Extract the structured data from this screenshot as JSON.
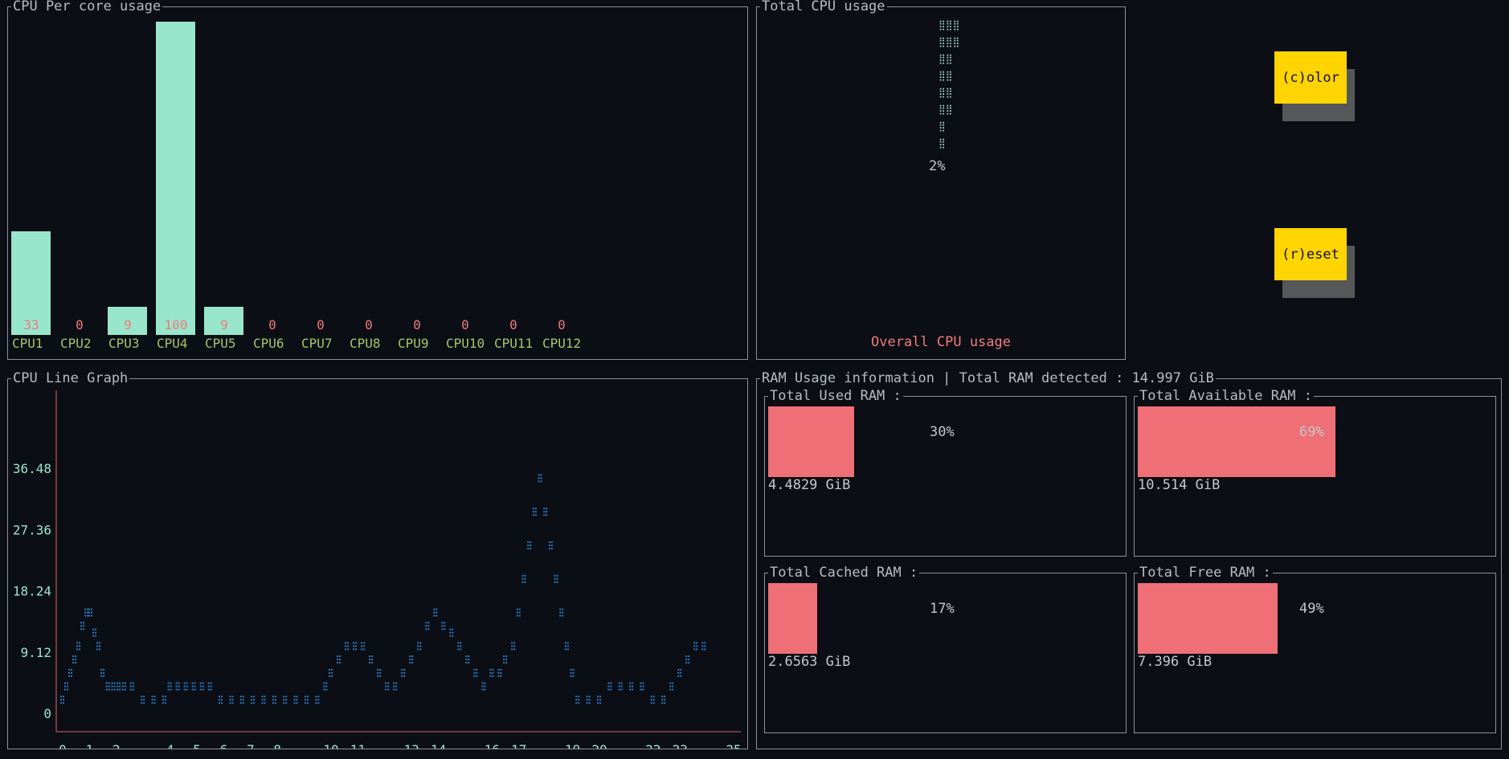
{
  "cpu_panel": {
    "title": "CPU Per core usage",
    "cores": [
      {
        "label": "CPU1",
        "value": 33
      },
      {
        "label": "CPU2",
        "value": 0
      },
      {
        "label": "CPU3",
        "value": 9
      },
      {
        "label": "CPU4",
        "value": 100
      },
      {
        "label": "CPU5",
        "value": 9
      },
      {
        "label": "CPU6",
        "value": 0
      },
      {
        "label": "CPU7",
        "value": 0
      },
      {
        "label": "CPU8",
        "value": 0
      },
      {
        "label": "CPU9",
        "value": 0
      },
      {
        "label": "CPU10",
        "value": 0
      },
      {
        "label": "CPU11",
        "value": 0
      },
      {
        "label": "CPU12",
        "value": 0
      }
    ],
    "bar_color": "#98e6cc",
    "value_color": "#ee7a7f",
    "label_color": "#a7c46a"
  },
  "total_cpu": {
    "title": "Total CPU usage",
    "percent_label": "2%",
    "footer": "Overall CPU usage",
    "footer_color": "#ee7a7f",
    "value": 2
  },
  "buttons": {
    "color_label": "(c)olor",
    "reset_label": "(r)eset",
    "bg_color": "#ffd400"
  },
  "line_graph": {
    "title": "CPU Line Graph"
  },
  "ram": {
    "title": "RAM Usage information | Total RAM detected : 14.997 GiB",
    "boxes": [
      {
        "title": "Total Used RAM :",
        "percent": 30,
        "percent_label": "30%",
        "value": "4.4829 GiB"
      },
      {
        "title": "Total Available RAM :",
        "percent": 69,
        "percent_label": "69%",
        "value": "10.514 GiB"
      },
      {
        "title": "Total Cached RAM :",
        "percent": 17,
        "percent_label": "17%",
        "value": "2.6563 GiB"
      },
      {
        "title": "Total Free RAM :",
        "percent": 49,
        "percent_label": "49%",
        "value": "7.396 GiB"
      }
    ],
    "bar_color": "#ef6f76"
  },
  "chart_data": {
    "type": "line",
    "title": "CPU Line Graph",
    "xlabel": "",
    "ylabel": "",
    "x_ticks": [
      "0",
      "1",
      "2",
      "4",
      "5",
      "6",
      "7",
      "8",
      "10",
      "11",
      "13",
      "14",
      "16",
      "17",
      "19",
      "20",
      "22",
      "23",
      "25"
    ],
    "y_ticks": [
      "0",
      "9.12",
      "18.24",
      "27.36",
      "36.48"
    ],
    "ylim": [
      0,
      36.48
    ],
    "xlim": [
      0,
      25
    ],
    "series": [
      {
        "values": [
          [
            0.0,
            2
          ],
          [
            0.15,
            4
          ],
          [
            0.3,
            6
          ],
          [
            0.45,
            8
          ],
          [
            0.6,
            10
          ],
          [
            0.75,
            13
          ],
          [
            0.9,
            15
          ],
          [
            1.05,
            15
          ],
          [
            1.2,
            12
          ],
          [
            1.35,
            10
          ],
          [
            1.5,
            6
          ],
          [
            1.7,
            4
          ],
          [
            1.9,
            4
          ],
          [
            2.1,
            4
          ],
          [
            2.3,
            4
          ],
          [
            2.6,
            4
          ],
          [
            3.0,
            2
          ],
          [
            3.4,
            2
          ],
          [
            3.8,
            2
          ],
          [
            4.0,
            4
          ],
          [
            4.3,
            4
          ],
          [
            4.6,
            4
          ],
          [
            4.9,
            4
          ],
          [
            5.2,
            4
          ],
          [
            5.5,
            4
          ],
          [
            5.9,
            2
          ],
          [
            6.3,
            2
          ],
          [
            6.7,
            2
          ],
          [
            7.1,
            2
          ],
          [
            7.5,
            2
          ],
          [
            7.9,
            2
          ],
          [
            8.3,
            2
          ],
          [
            8.7,
            2
          ],
          [
            9.1,
            2
          ],
          [
            9.5,
            2
          ],
          [
            9.8,
            4
          ],
          [
            10.0,
            6
          ],
          [
            10.3,
            8
          ],
          [
            10.6,
            10
          ],
          [
            10.9,
            10
          ],
          [
            11.2,
            10
          ],
          [
            11.5,
            8
          ],
          [
            11.8,
            6
          ],
          [
            12.1,
            4
          ],
          [
            12.4,
            4
          ],
          [
            12.7,
            6
          ],
          [
            13.0,
            8
          ],
          [
            13.3,
            10
          ],
          [
            13.6,
            13
          ],
          [
            13.9,
            15
          ],
          [
            14.2,
            13
          ],
          [
            14.5,
            12
          ],
          [
            14.8,
            10
          ],
          [
            15.1,
            8
          ],
          [
            15.4,
            6
          ],
          [
            15.7,
            4
          ],
          [
            16.0,
            6
          ],
          [
            16.3,
            6
          ],
          [
            16.5,
            8
          ],
          [
            16.8,
            10
          ],
          [
            17.0,
            15
          ],
          [
            17.2,
            20
          ],
          [
            17.4,
            25
          ],
          [
            17.6,
            30
          ],
          [
            17.8,
            35
          ],
          [
            18.0,
            30
          ],
          [
            18.2,
            25
          ],
          [
            18.4,
            20
          ],
          [
            18.6,
            15
          ],
          [
            18.8,
            10
          ],
          [
            19.0,
            6
          ],
          [
            19.2,
            2
          ],
          [
            19.6,
            2
          ],
          [
            20.0,
            2
          ],
          [
            20.4,
            4
          ],
          [
            20.8,
            4
          ],
          [
            21.2,
            4
          ],
          [
            21.6,
            4
          ],
          [
            22.0,
            2
          ],
          [
            22.4,
            2
          ],
          [
            22.7,
            4
          ],
          [
            23.0,
            6
          ],
          [
            23.3,
            8
          ],
          [
            23.6,
            10
          ],
          [
            23.9,
            10
          ]
        ]
      }
    ],
    "line_color": "#2c7bc4",
    "axis_color": "#e2616a",
    "tick_label_color": "#98e6cc"
  }
}
